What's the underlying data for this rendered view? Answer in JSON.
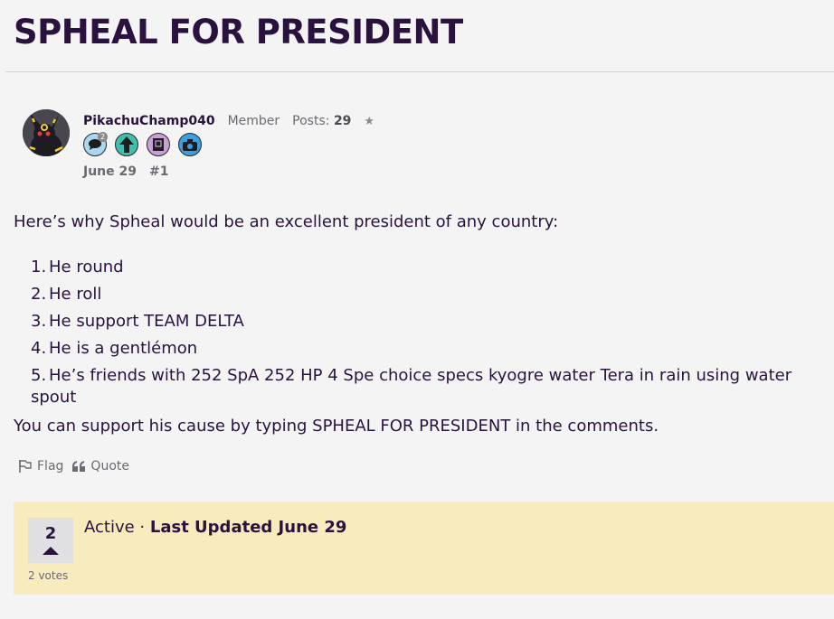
{
  "topic": {
    "title": "SPHEAL FOR PRESIDENT"
  },
  "post": {
    "author": {
      "username": "PikachuChamp040",
      "role": "Member",
      "posts_label": "Posts:",
      "posts_count": "29",
      "star": "★",
      "avatar": "umbreon-avatar",
      "badges": [
        {
          "icon": "speech-bubble-icon",
          "count": "2",
          "color": "#a9d8ee"
        },
        {
          "icon": "up-arrow-icon",
          "color": "#3fbfb0"
        },
        {
          "icon": "notebook-icon",
          "color": "#c9a0d6"
        },
        {
          "icon": "camera-icon",
          "color": "#3d9ee0"
        }
      ]
    },
    "date": "June 29",
    "number": "#1",
    "intro": "Here’s why Spheal would be an excellent president of any country:",
    "list": [
      {
        "num": "1.",
        "text": "He round"
      },
      {
        "num": "2.",
        "text": "He roll"
      },
      {
        "num": "3.",
        "text": "He support TEAM DELTA"
      },
      {
        "num": "4.",
        "text": "He is a gentlémon"
      },
      {
        "num": "5.",
        "text": "He’s friends with 252 SpA 252 HP 4 Spe choice specs kyogre water Tera in rain using water spout"
      }
    ],
    "outro": "You can support his cause by typing SPHEAL FOR PRESIDENT in the comments.",
    "actions": {
      "flag_label": "Flag",
      "quote_label": "Quote"
    }
  },
  "status": {
    "vote_count": "2",
    "votes_label": "2 votes",
    "state": "Active",
    "separator": " · ",
    "updated": "Last Updated June 29",
    "background": "#f8ebbd"
  }
}
